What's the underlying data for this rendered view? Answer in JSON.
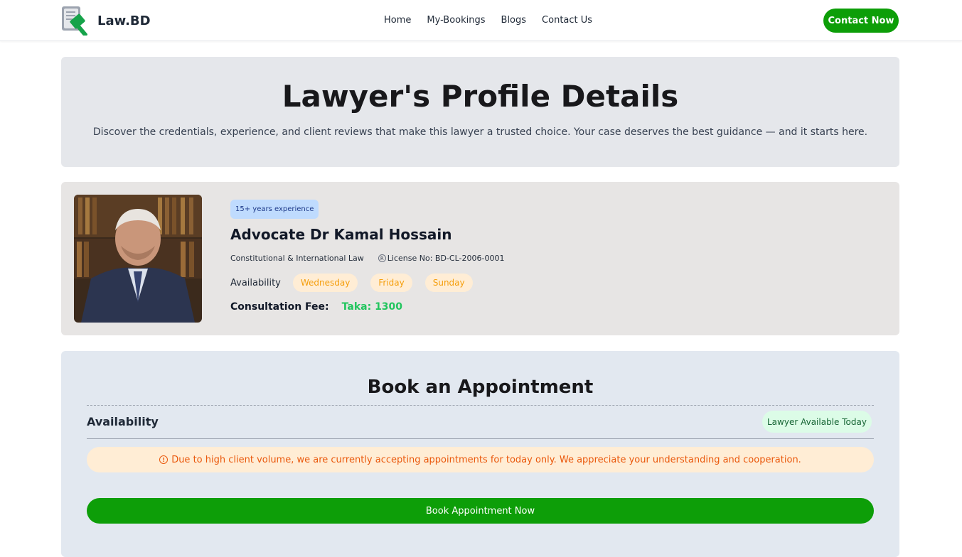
{
  "brand": {
    "name": "Law.BD",
    "logo_icon": "gavel-document-icon"
  },
  "nav": {
    "links": [
      "Home",
      "My-Bookings",
      "Blogs",
      "Contact Us"
    ]
  },
  "header": {
    "contact_label": "Contact Now"
  },
  "hero": {
    "title": "Lawyer's Profile Details",
    "subtitle": "Discover the credentials, experience, and client reviews that make this lawyer a trusted choice. Your case deserves the best guidance — and it starts here."
  },
  "profile": {
    "experience": "15+ years experience",
    "name": "Advocate Dr Kamal Hossain",
    "specialty": "Constitutional & International Law",
    "license_icon": "registered-icon",
    "license": "License No: BD-CL-2006-0001",
    "availability_label": "Availability",
    "days": [
      "Wednesday",
      "Friday",
      "Sunday"
    ],
    "fee_label": "Consultation Fee:",
    "fee_value": "Taka: 1300"
  },
  "booking": {
    "title": "Book an Appointment",
    "availability_label": "Availability",
    "status_badge": "Lawyer Available Today",
    "notice": "Due to high client volume, we are currently accepting appointments for today only. We appreciate your understanding and cooperation.",
    "notice_icon": "info-icon",
    "button_label": "Book Appointment Now"
  },
  "colors": {
    "accent": "#0d9e08",
    "fee": "#22c55e",
    "day_pill_text": "#f59e0b",
    "notice_text": "#ea580c"
  }
}
